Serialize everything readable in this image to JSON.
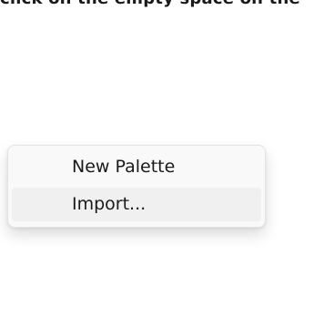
{
  "background_hint": {
    "text": "click on the empty space on the"
  },
  "context_menu": {
    "items": [
      {
        "label": "New Palette"
      },
      {
        "label": "Import..."
      }
    ]
  }
}
